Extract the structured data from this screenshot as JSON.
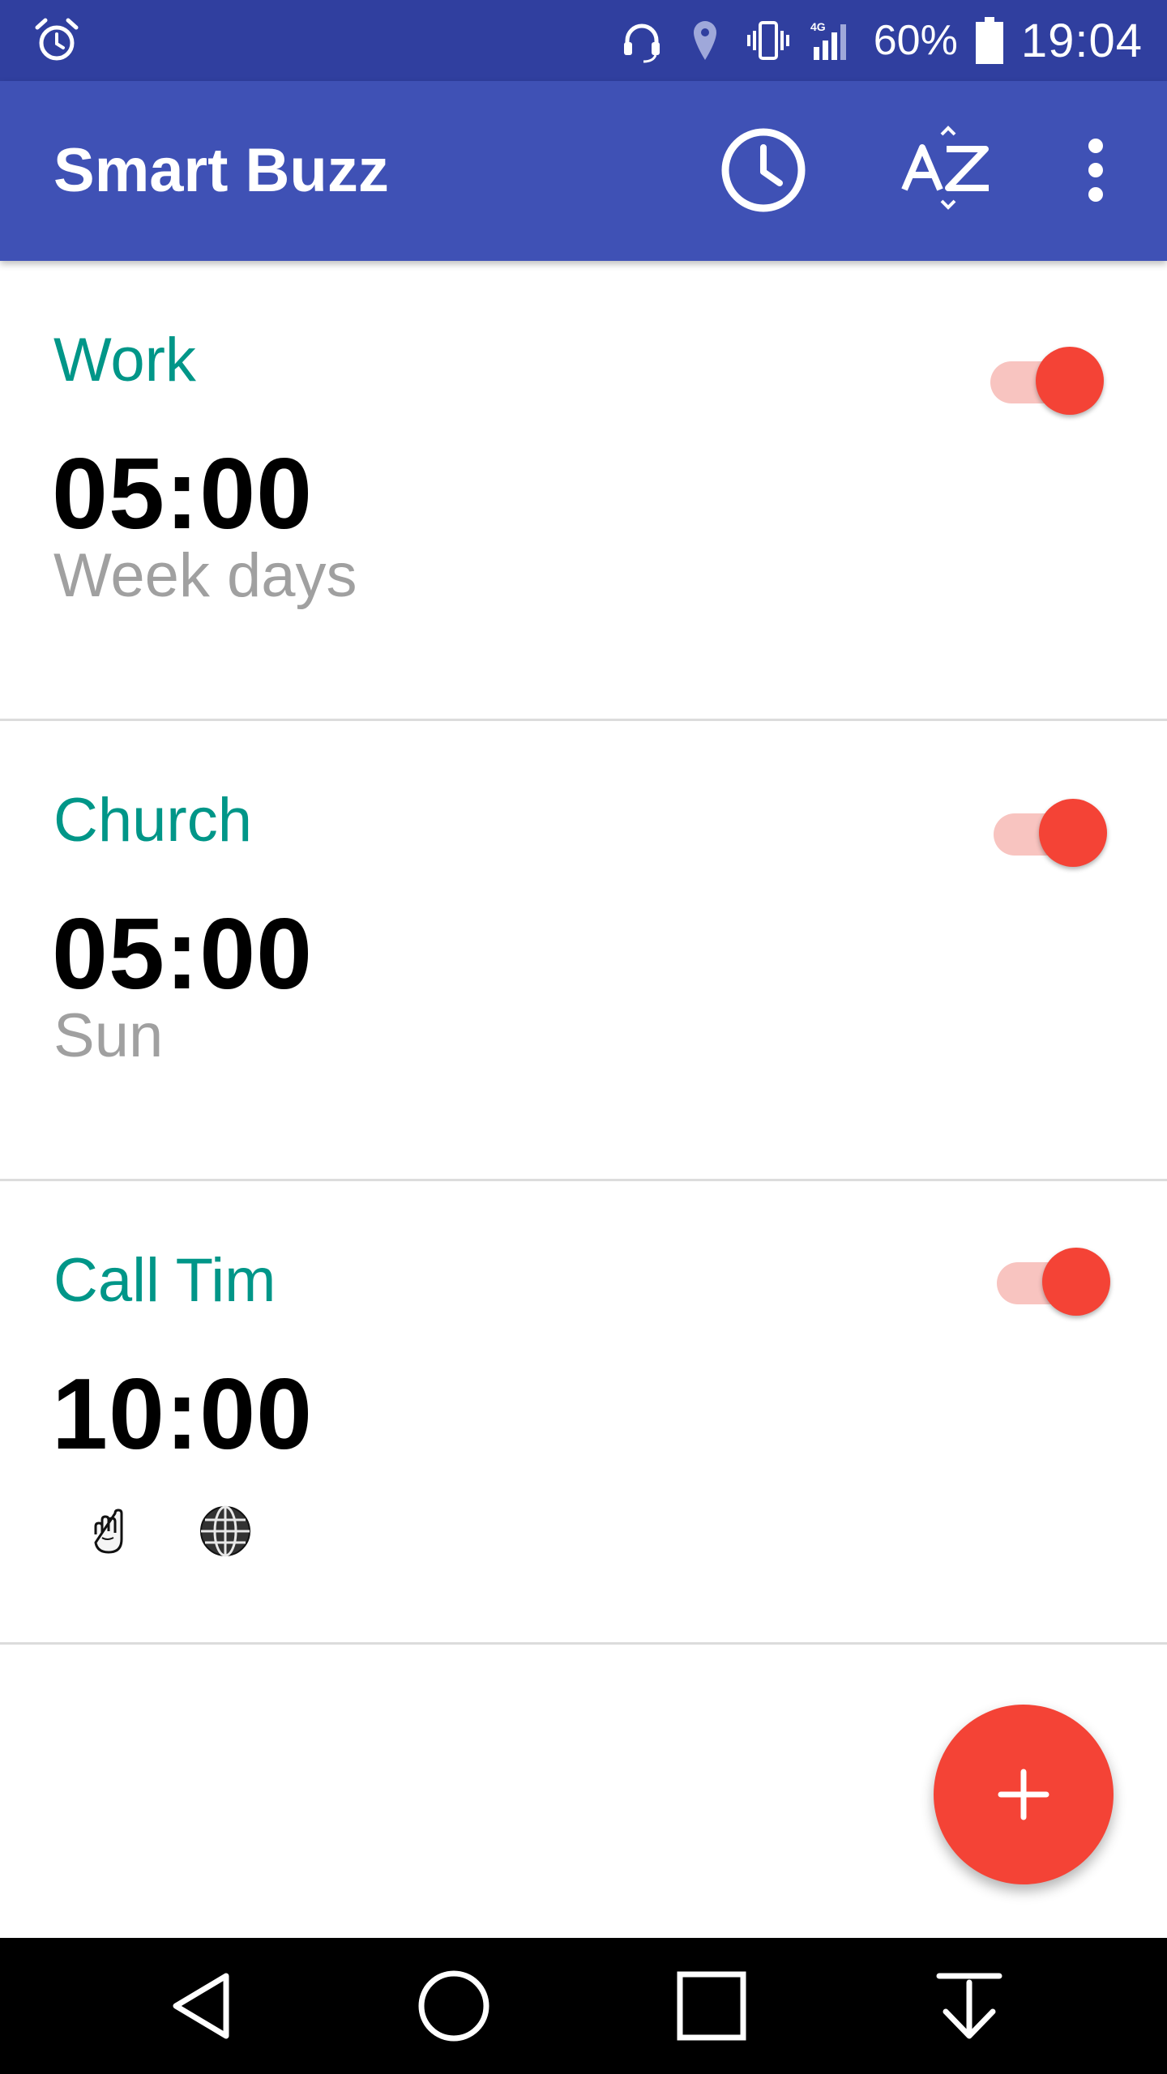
{
  "status_bar": {
    "icons": [
      "alarm-icon",
      "headset-icon",
      "location-icon",
      "vibrate-icon",
      "signal-4g-icon"
    ],
    "network_label": "4G",
    "battery_percent": "60%",
    "time": "19:04"
  },
  "app_bar": {
    "title": "Smart Buzz",
    "actions": [
      "history-icon",
      "sort-az-icon",
      "more-vert-icon"
    ]
  },
  "alarms": [
    {
      "name": "Work",
      "time": "05:00",
      "days": "Week days",
      "enabled": true,
      "extras": []
    },
    {
      "name": "Church",
      "time": "05:00",
      "days": "Sun",
      "enabled": true,
      "extras": []
    },
    {
      "name": "Call Tim",
      "time": "10:00",
      "days": "",
      "enabled": true,
      "extras": [
        "hand-icon",
        "globe-icon"
      ]
    }
  ],
  "fab": {
    "icon": "plus-icon"
  },
  "nav_bar": {
    "buttons": [
      "back-icon",
      "home-icon",
      "recents-icon",
      "notifications-down-icon"
    ]
  },
  "colors": {
    "status_bar": "#303f9f",
    "app_bar": "#3f51b5",
    "accent_teal": "#009688",
    "toggle_on": "#f44336",
    "toggle_track": "#f8c4c0",
    "fab": "#f44336",
    "secondary_text": "#a0a0a0"
  }
}
